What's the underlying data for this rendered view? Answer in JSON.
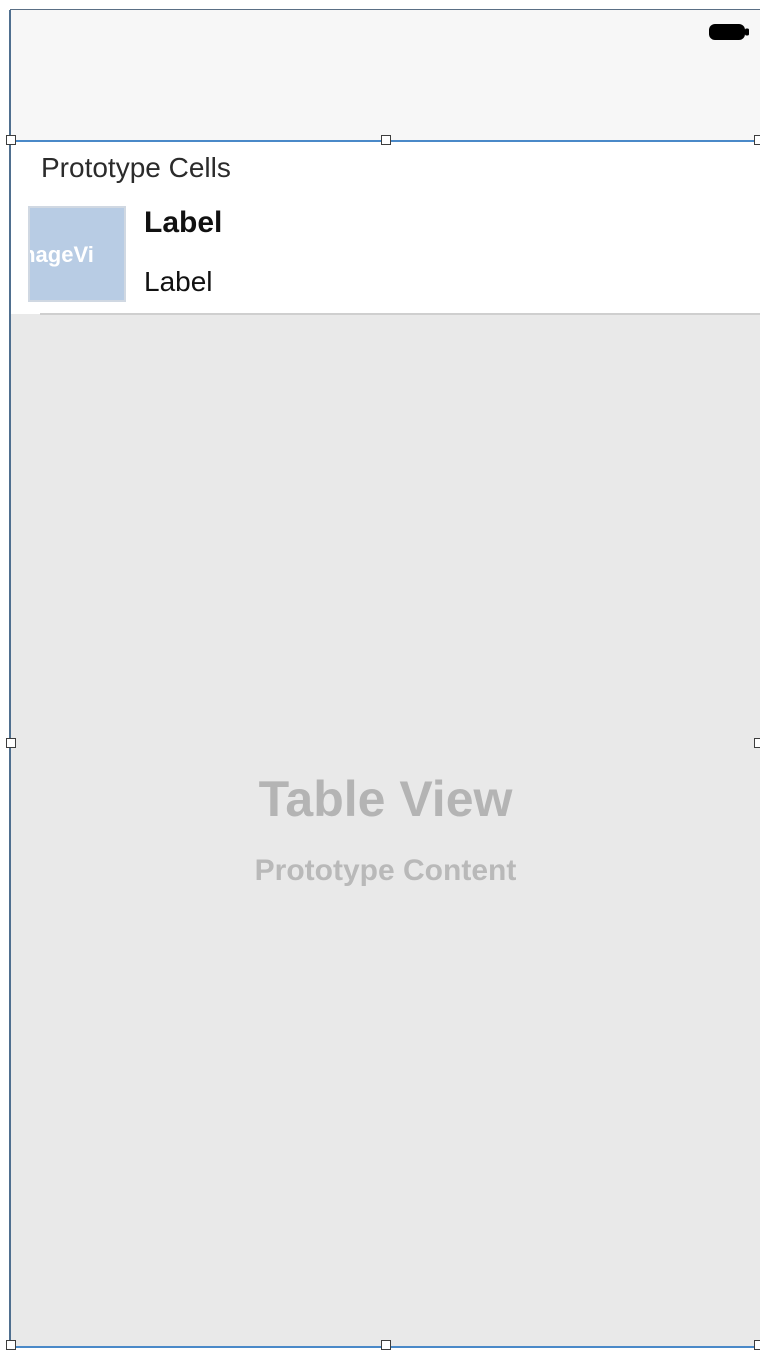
{
  "status_bar": {
    "battery_icon": "battery-icon"
  },
  "table_view": {
    "section_header": "Prototype Cells",
    "prototype_cell": {
      "image_view_label": "mageVi",
      "title_label": "Label",
      "subtitle_label": "Label"
    },
    "placeholder_title": "Table View",
    "placeholder_subtitle": "Prototype Content"
  },
  "colors": {
    "selection": "#4a89c8",
    "table_background": "#e9e9e9",
    "image_view_fill": "#b8cce4",
    "placeholder_text": "#b4b4b4"
  }
}
